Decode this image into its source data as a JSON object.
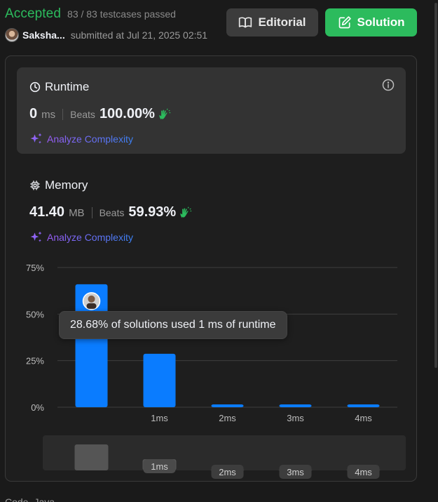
{
  "header": {
    "status": "Accepted",
    "testcases": "83 / 83 testcases passed",
    "user_name": "Saksha...",
    "submitted_at": "submitted at Jul 21, 2025 02:51",
    "editorial_label": "Editorial",
    "solution_label": "Solution"
  },
  "runtime": {
    "title": "Runtime",
    "value": "0",
    "unit": "ms",
    "beats_label": "Beats",
    "beats_value": "100.00%",
    "analyze_label": "Analyze Complexity"
  },
  "memory": {
    "title": "Memory",
    "value": "41.40",
    "unit": "MB",
    "beats_label": "Beats",
    "beats_value": "59.93%",
    "analyze_label": "Analyze Complexity"
  },
  "tooltip": "28.68% of solutions used 1 ms of runtime",
  "code_tab": {
    "label_a": "Code",
    "label_b": "Java"
  },
  "colors": {
    "accepted": "#2cbb5d",
    "bar": "#0a7cff",
    "analyze_gradient_start": "#9b5cf6",
    "analyze_gradient_end": "#3b82f6"
  },
  "chart_data": {
    "type": "bar",
    "categories": [
      "",
      "1ms",
      "2ms",
      "3ms",
      "4ms"
    ],
    "values": [
      66,
      28.68,
      1.5,
      1.5,
      1.5
    ],
    "ylim": [
      0,
      75
    ],
    "yticks": [
      "75%",
      "50%",
      "25%",
      "0%"
    ],
    "ytick_values": [
      75,
      50,
      25,
      0
    ],
    "grid": true,
    "highlight_index": 0,
    "navigator_labels": [
      "1ms",
      "2ms",
      "3ms",
      "4ms"
    ]
  }
}
